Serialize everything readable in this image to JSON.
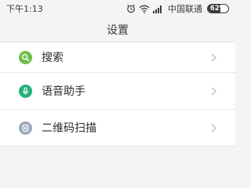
{
  "status_bar": {
    "time": "下午1:13",
    "carrier": "中国联通",
    "battery_percent": "62%",
    "battery_level": 0.62,
    "icons": [
      "alarm-icon",
      "wifi-icon",
      "signal-icon",
      "battery-icon"
    ]
  },
  "header": {
    "title": "设置"
  },
  "colors": {
    "search_icon_bg": "#6fbf4a",
    "voice_icon_bg": "#26b07a",
    "qr_icon_bg": "#9aa9b8",
    "chevron": "#bdbdbd",
    "text": "#2a2a2a"
  },
  "list": {
    "items": [
      {
        "label": "搜索",
        "icon": "search-icon"
      },
      {
        "label": "语音助手",
        "icon": "microphone-icon"
      },
      {
        "label": "二维码扫描",
        "icon": "qr-scan-icon"
      }
    ]
  }
}
